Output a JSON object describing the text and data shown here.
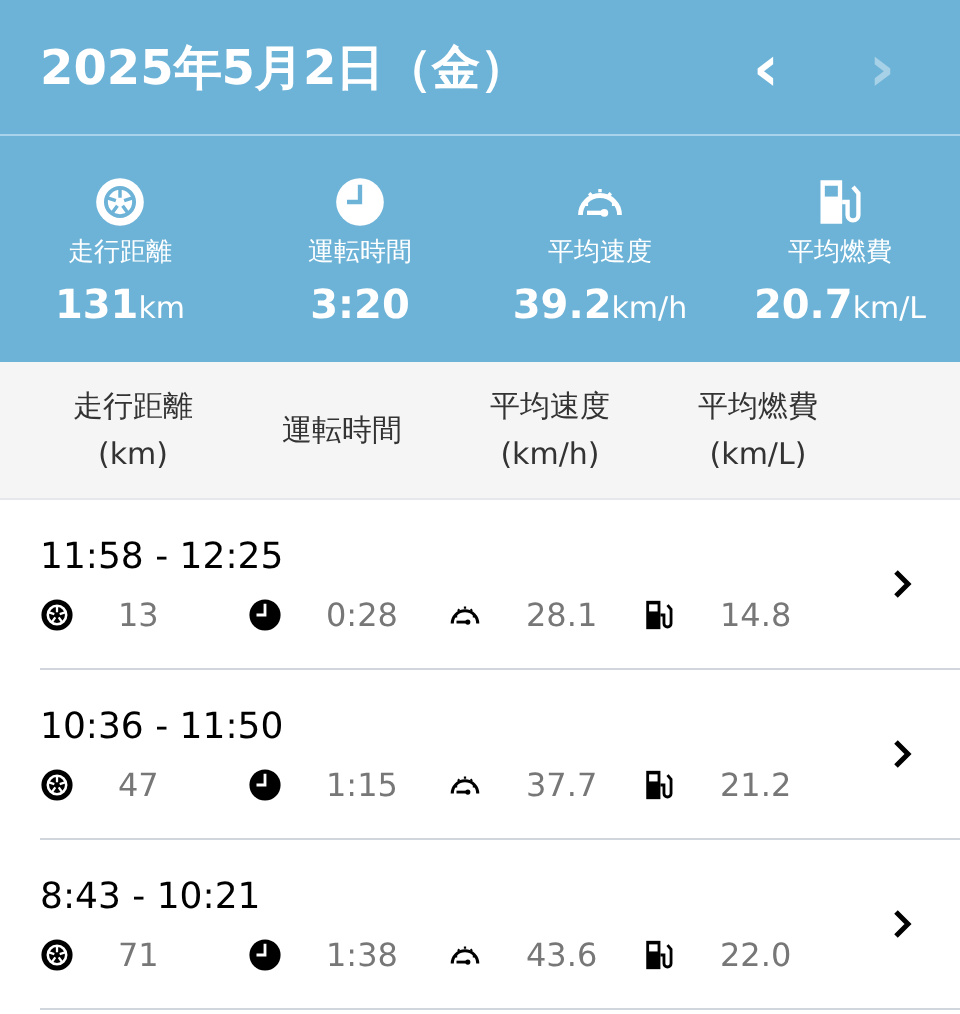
{
  "header": {
    "title": "2025年5月2日（金）",
    "prev": {
      "label": "‹",
      "disabled": false
    },
    "next": {
      "label": "›",
      "disabled": true
    }
  },
  "summary": [
    {
      "kind": "distance",
      "label": "走行距離",
      "value": "131",
      "unit": "km"
    },
    {
      "kind": "time",
      "label": "運転時間",
      "value": "3:20"
    },
    {
      "kind": "speed",
      "label": "平均速度",
      "value": "39.2",
      "unit": "km/h"
    },
    {
      "kind": "fuel",
      "label": "平均燃費",
      "value": "20.7",
      "unit": "km/L"
    }
  ],
  "table": {
    "columns": [
      [
        "走行距離",
        "(km)"
      ],
      [
        "運転時間"
      ],
      [
        "平均速度",
        "(km/h)"
      ],
      [
        "平均燃費",
        "(km/L)"
      ]
    ],
    "rows": [
      {
        "time": "11:58 - 12:25",
        "values": [
          {
            "kind": "distance",
            "text": "13"
          },
          {
            "kind": "time",
            "text": "0:28"
          },
          {
            "kind": "speed",
            "text": "28.1"
          },
          {
            "kind": "fuel",
            "text": "14.8"
          }
        ]
      },
      {
        "time": "10:36 - 11:50",
        "values": [
          {
            "kind": "distance",
            "text": "47"
          },
          {
            "kind": "time",
            "text": "1:15"
          },
          {
            "kind": "speed",
            "text": "37.7"
          },
          {
            "kind": "fuel",
            "text": "21.2"
          }
        ]
      },
      {
        "time": "8:43 - 10:21",
        "values": [
          {
            "kind": "distance",
            "text": "71"
          },
          {
            "kind": "time",
            "text": "1:38"
          },
          {
            "kind": "speed",
            "text": "43.6"
          },
          {
            "kind": "fuel",
            "text": "22.0"
          }
        ]
      }
    ]
  }
}
